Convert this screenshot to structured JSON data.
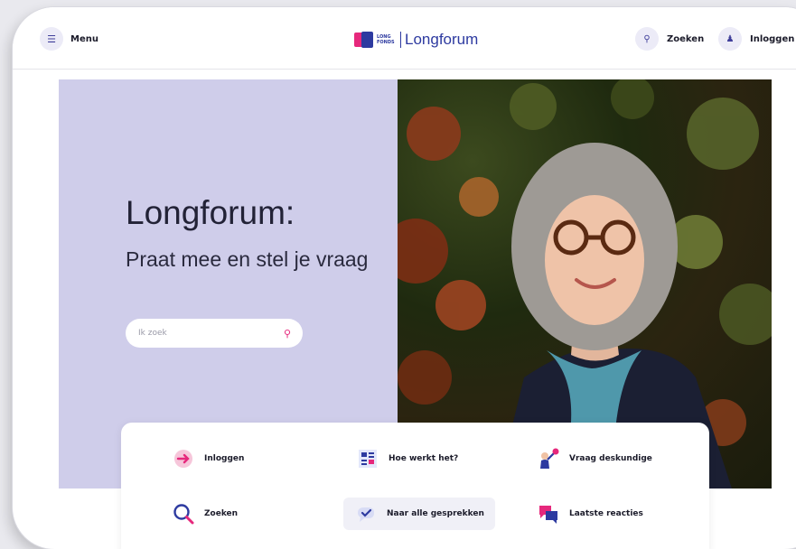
{
  "header": {
    "menu_label": "Menu",
    "logo_small_text": "LONG FONDS",
    "logo_title": "Longforum",
    "search_label": "Zoeken",
    "login_label": "Inloggen"
  },
  "hero": {
    "title": "Longforum:",
    "subtitle": "Praat mee en stel je vraag",
    "search_placeholder": "Ik zoek"
  },
  "quick_links": [
    {
      "label": "Inloggen",
      "icon": "login-arrow-icon"
    },
    {
      "label": "Hoe werkt het?",
      "icon": "how-it-works-icon"
    },
    {
      "label": "Vraag deskundige",
      "icon": "ask-expert-icon"
    },
    {
      "label": "Zoeken",
      "icon": "magnifier-icon"
    },
    {
      "label": "Naar alle gesprekken",
      "icon": "conversations-icon"
    },
    {
      "label": "Laatste reacties",
      "icon": "latest-replies-icon"
    }
  ],
  "colors": {
    "brand_blue": "#2d3aa0",
    "brand_pink": "#e6287c",
    "hero_lilac": "#cfcdea"
  }
}
